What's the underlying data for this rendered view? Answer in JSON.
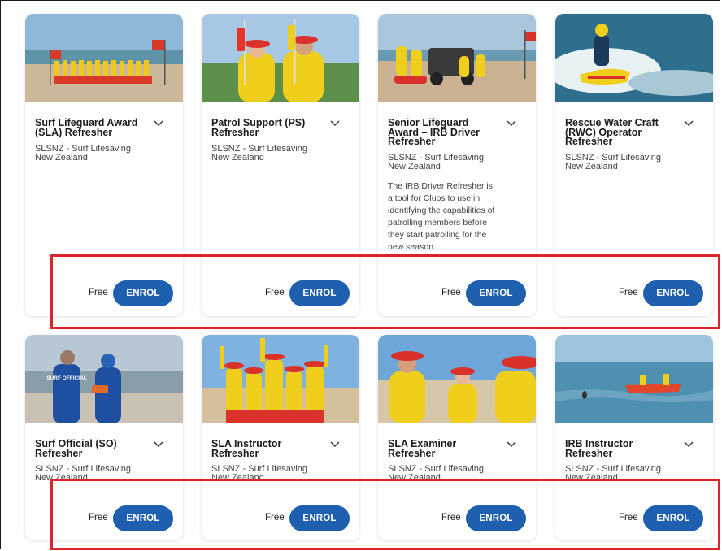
{
  "accent_color": "#1f5fb0",
  "highlight_color": "#d8242a",
  "courses": [
    {
      "title": "Surf Lifeguard Award (SLA) Refresher",
      "org": "SLSNZ - Surf Lifesaving New Zealand",
      "description": "",
      "price": "Free",
      "action": "ENROL",
      "image_icon": "lifeguard-team-with-flags-photo"
    },
    {
      "title": "Patrol Support (PS) Refresher",
      "org": "SLSNZ - Surf Lifesaving New Zealand",
      "description": "",
      "price": "Free",
      "action": "ENROL",
      "image_icon": "two-lifeguards-with-flags-photo"
    },
    {
      "title": "Senior Lifeguard Award – IRB Driver Refresher",
      "org": "SLSNZ - Surf Lifesaving New Zealand",
      "description": "The IRB Driver Refresher is a tool for Clubs to use in identifying the capabilities of patrolling members before they start patrolling for the new season.",
      "price": "Free",
      "action": "ENROL",
      "image_icon": "lifeguards-with-beach-vehicle-photo"
    },
    {
      "title": "Rescue Water Craft (RWC) Operator Refresher",
      "org": "SLSNZ - Surf Lifesaving New Zealand",
      "description": "",
      "price": "Free",
      "action": "ENROL",
      "image_icon": "jet-ski-rescue-photo"
    },
    {
      "title": "Surf Official (SO) Refresher",
      "org": "SLSNZ - Surf Lifesaving New Zealand",
      "description": "",
      "price": "Free",
      "action": "ENROL",
      "image_icon": "surf-official-on-beach-photo",
      "image_text": "SURF OFFICIAL"
    },
    {
      "title": "SLA Instructor Refresher",
      "org": "SLSNZ - Surf Lifesaving New Zealand",
      "description": "",
      "price": "Free",
      "action": "ENROL",
      "image_icon": "cheering-lifeguards-photo"
    },
    {
      "title": "SLA Examiner Refresher",
      "org": "SLSNZ - Surf Lifesaving New Zealand",
      "description": "",
      "price": "Free",
      "action": "ENROL",
      "image_icon": "lifeguards-talking-photo"
    },
    {
      "title": "IRB Instructor Refresher",
      "org": "SLSNZ - Surf Lifesaving New Zealand",
      "description": "",
      "price": "Free",
      "action": "ENROL",
      "image_icon": "inflatable-rescue-boat-photo"
    }
  ]
}
